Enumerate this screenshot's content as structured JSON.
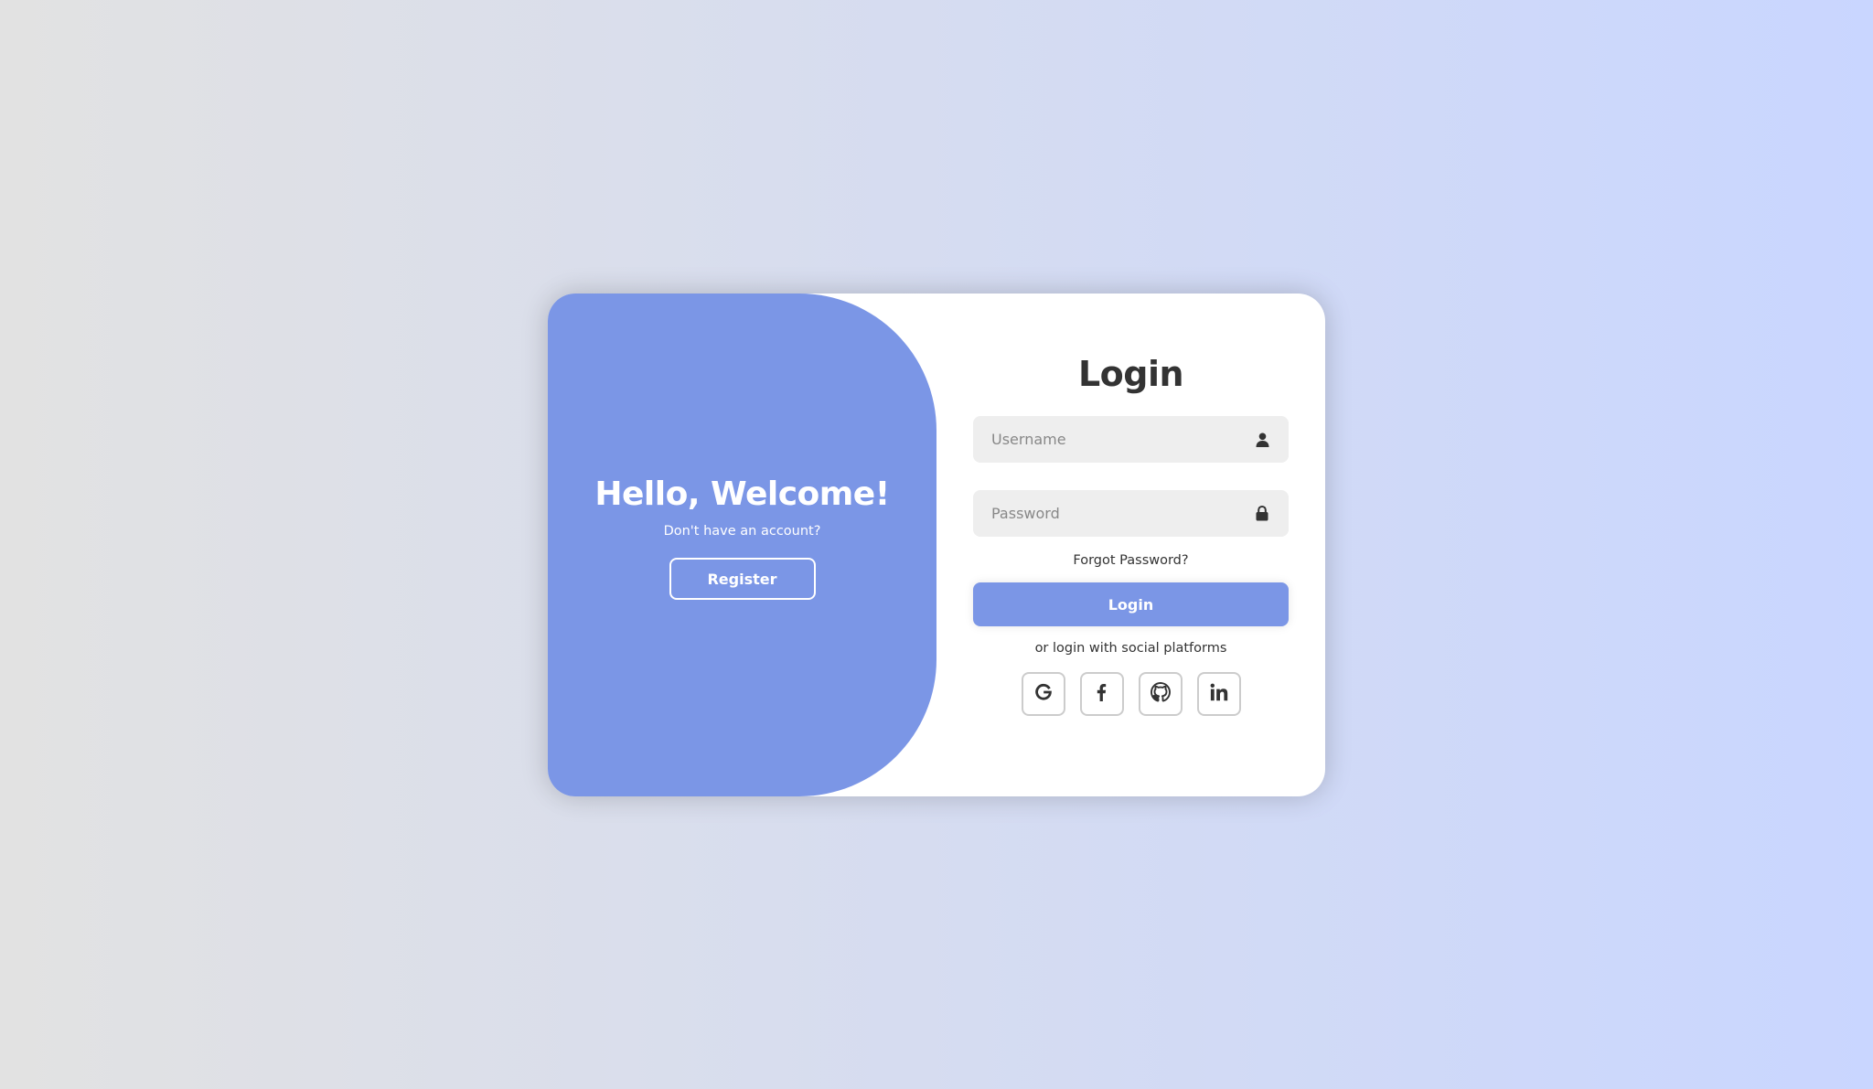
{
  "welcome_panel": {
    "title": "Hello, Welcome!",
    "subtitle": "Don't have an account?",
    "register_label": "Register"
  },
  "login_form": {
    "title": "Login",
    "username_placeholder": "Username",
    "password_placeholder": "Password",
    "forgot_label": "Forgot Password?",
    "login_label": "Login",
    "social_text": "or login with social platforms",
    "social_icons": [
      "google-icon",
      "facebook-icon",
      "github-icon",
      "linkedin-icon"
    ]
  },
  "colors": {
    "accent": "#7b96e6",
    "background_start": "#e2e2e2",
    "background_end": "#c9d6ff",
    "text": "#333333",
    "input_bg": "#eeeeee"
  }
}
